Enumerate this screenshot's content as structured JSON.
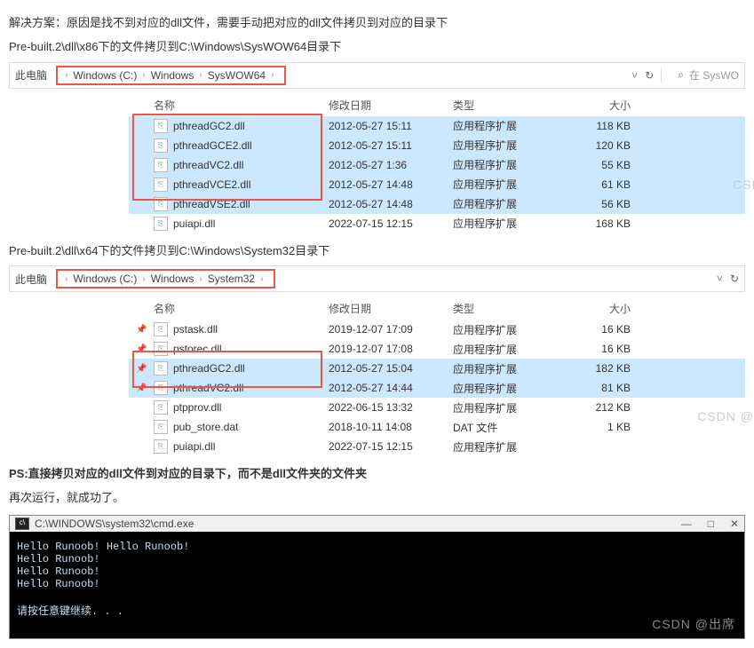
{
  "text": {
    "intro": "解决方案：原因是找不到对应的dll文件，需要手动把对应的dll文件拷贝到对应的目录下",
    "copy1": "Pre-built.2\\dll\\x86下的文件拷贝到C:\\Windows\\SysWOW64目录下",
    "copy2": "Pre-built.2\\dll\\x64下的文件拷贝到C:\\Windows\\System32目录下",
    "ps": "PS:直接拷贝对应的dll文件到对应的目录下，而不是dll文件夹的文件夹",
    "rerun": "再次运行，就成功了。"
  },
  "bc1": {
    "root": "此电脑",
    "segs": [
      "Windows (C:)",
      "Windows",
      "SysWOW64"
    ],
    "refresh": "↻",
    "search_ph": "在 SysWO"
  },
  "bc2": {
    "root": "此电脑",
    "segs": [
      "Windows (C:)",
      "Windows",
      "System32"
    ],
    "refresh": "↻"
  },
  "headers": {
    "name": "名称",
    "date": "修改日期",
    "type": "类型",
    "size": "大小"
  },
  "files1": [
    {
      "sel": true,
      "name": "pthreadGC2.dll",
      "date": "2012-05-27 15:11",
      "type": "应用程序扩展",
      "size": "118 KB"
    },
    {
      "sel": true,
      "name": "pthreadGCE2.dll",
      "date": "2012-05-27 15:11",
      "type": "应用程序扩展",
      "size": "120 KB"
    },
    {
      "sel": true,
      "name": "pthreadVC2.dll",
      "date": "2012-05-27 1:36",
      "type": "应用程序扩展",
      "size": "55 KB"
    },
    {
      "sel": true,
      "name": "pthreadVCE2.dll",
      "date": "2012-05-27 14:48",
      "type": "应用程序扩展",
      "size": "61 KB"
    },
    {
      "sel": true,
      "name": "pthreadVSE2.dll",
      "date": "2012-05-27 14:48",
      "type": "应用程序扩展",
      "size": "56 KB"
    },
    {
      "sel": false,
      "name": "puiapi.dll",
      "date": "2022-07-15 12:15",
      "type": "应用程序扩展",
      "size": "168 KB"
    }
  ],
  "files2": [
    {
      "sel": false,
      "pin": true,
      "name": "pstask.dll",
      "date": "2019-12-07 17:09",
      "type": "应用程序扩展",
      "size": "16 KB"
    },
    {
      "sel": false,
      "pin": true,
      "name": "pstorec.dll",
      "date": "2019-12-07 17:08",
      "type": "应用程序扩展",
      "size": "16 KB"
    },
    {
      "sel": true,
      "pin": true,
      "name": "pthreadGC2.dll",
      "date": "2012-05-27 15:04",
      "type": "应用程序扩展",
      "size": "182 KB"
    },
    {
      "sel": true,
      "pin": true,
      "name": "pthreadVC2.dll",
      "date": "2012-05-27 14:44",
      "type": "应用程序扩展",
      "size": "81 KB"
    },
    {
      "sel": false,
      "name": "ptpprov.dll",
      "date": "2022-06-15 13:32",
      "type": "应用程序扩展",
      "size": "212 KB"
    },
    {
      "sel": false,
      "name": "pub_store.dat",
      "date": "2018-10-11 14:08",
      "type": "DAT 文件",
      "size": "1 KB"
    },
    {
      "sel": false,
      "name": "puiapi.dll",
      "date": "2022-07-15 12:15",
      "type": "应用程序扩展",
      "size": "",
      "wm": true
    }
  ],
  "wm1": "CSDN @余生爱静",
  "wm2": "CSDN @余生爱静",
  "cmd": {
    "title": "C:\\WINDOWS\\system32\\cmd.exe",
    "lines": [
      "Hello Runoob! Hello Runoob!",
      "Hello Runoob!",
      "Hello Runoob!",
      "Hello Runoob!",
      "",
      "请按任意键继续. . ."
    ],
    "wm": "CSDN @出席",
    "btns": {
      "min": "—",
      "max": "□",
      "close": "✕"
    }
  }
}
